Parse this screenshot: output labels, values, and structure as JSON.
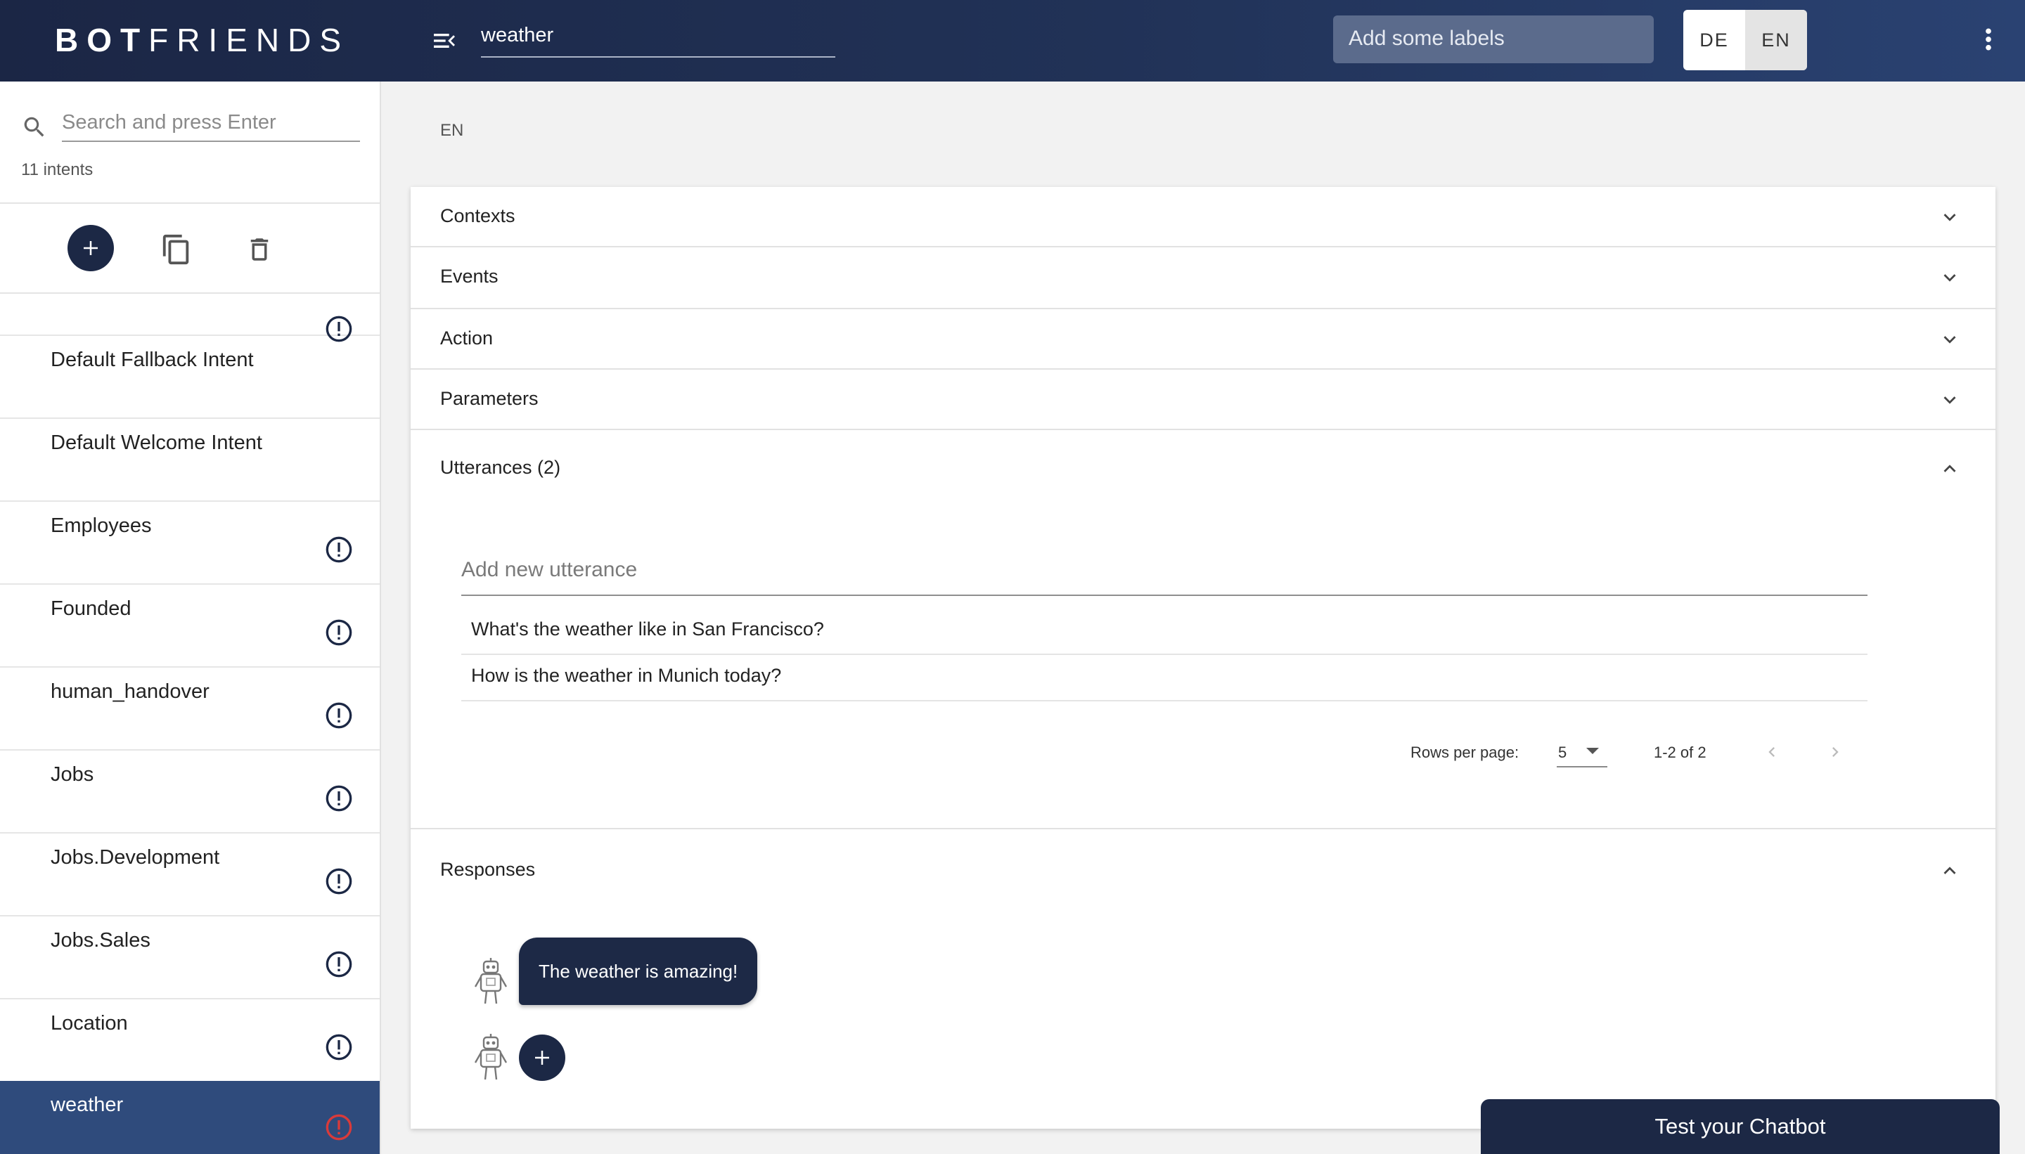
{
  "header": {
    "logo_bold": "BOT",
    "logo_light": "FRIENDS",
    "intent_name": "weather",
    "labels_placeholder": "Add some labels",
    "languages": [
      "DE",
      "EN"
    ],
    "active_language": "EN"
  },
  "sidebar": {
    "search_placeholder": "Search and press Enter",
    "intent_count": "11 intents",
    "items": [
      {
        "label": "Default Fallback Intent",
        "warning": false
      },
      {
        "label": "Default Welcome Intent",
        "warning": false
      },
      {
        "label": "Employees",
        "warning": true
      },
      {
        "label": "Founded",
        "warning": true
      },
      {
        "label": "human_handover",
        "warning": true
      },
      {
        "label": "Jobs",
        "warning": true
      },
      {
        "label": "Jobs.Development",
        "warning": true
      },
      {
        "label": "Jobs.Sales",
        "warning": true
      },
      {
        "label": "Location",
        "warning": true
      },
      {
        "label": "weather",
        "warning": true,
        "selected": true
      }
    ]
  },
  "main": {
    "language": "EN",
    "panels": {
      "contexts": "Contexts",
      "events": "Events",
      "action": "Action",
      "parameters": "Parameters",
      "utterances": "Utterances (2)",
      "responses": "Responses"
    },
    "utterances": {
      "placeholder": "Add new utterance",
      "rows": [
        "What's the weather like in San Francisco?",
        "How is the weather in Munich today?"
      ],
      "pager": {
        "rows_per_page_label": "Rows per page:",
        "rows_per_page": "5",
        "range": "1-2 of 2"
      }
    },
    "responses": {
      "items": [
        "The weather is amazing!"
      ]
    }
  },
  "test_chatbot_label": "Test your Chatbot",
  "colors": {
    "header_dark": "#1b2645",
    "accent_navy": "#1c2845",
    "selected_bg": "#2f4b7c",
    "warning_normal": "#1c2845",
    "warning_active": "#d93a3a"
  }
}
